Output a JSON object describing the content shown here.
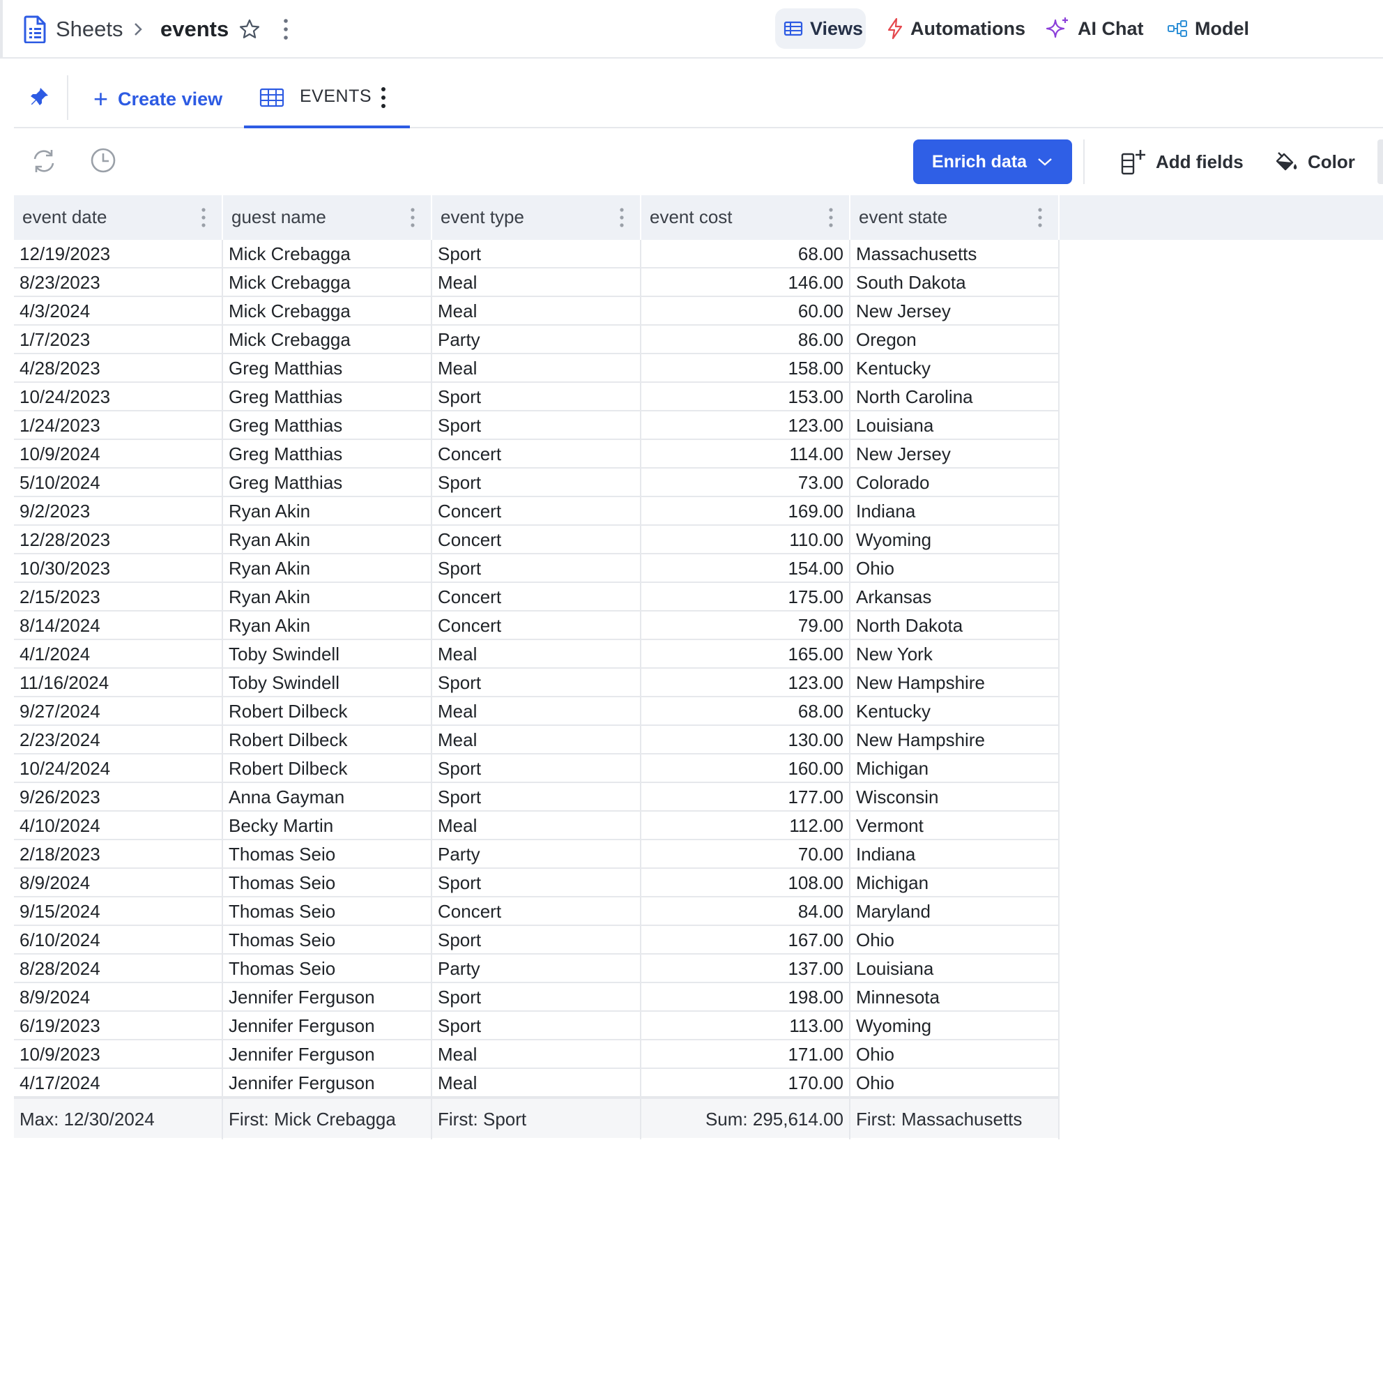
{
  "breadcrumb": {
    "root": "Sheets",
    "separator": ">",
    "current": "events"
  },
  "topnav": {
    "views": "Views",
    "automations": "Automations",
    "ai_chat": "AI Chat",
    "model": "Model"
  },
  "tabs": {
    "create_view": "Create view",
    "active_tab": "EVENTS"
  },
  "toolbar": {
    "enrich_data": "Enrich data",
    "add_fields": "Add fields",
    "color": "Color"
  },
  "colors": {
    "accent": "#2f5fe6",
    "header_bg": "#eef1f6",
    "grid_line": "#e6e8ec",
    "ai_purple": "#8b3fd9",
    "automation_red": "#e5484d"
  },
  "columns": [
    "event date",
    "guest name",
    "event type",
    "event cost",
    "event state"
  ],
  "rows": [
    [
      "12/19/2023",
      "Mick Crebagga",
      "Sport",
      "68.00",
      "Massachusetts"
    ],
    [
      "8/23/2023",
      "Mick Crebagga",
      "Meal",
      "146.00",
      "South Dakota"
    ],
    [
      "4/3/2024",
      "Mick Crebagga",
      "Meal",
      "60.00",
      "New Jersey"
    ],
    [
      "1/7/2023",
      "Mick Crebagga",
      "Party",
      "86.00",
      "Oregon"
    ],
    [
      "4/28/2023",
      "Greg Matthias",
      "Meal",
      "158.00",
      "Kentucky"
    ],
    [
      "10/24/2023",
      "Greg Matthias",
      "Sport",
      "153.00",
      "North Carolina"
    ],
    [
      "1/24/2023",
      "Greg Matthias",
      "Sport",
      "123.00",
      "Louisiana"
    ],
    [
      "10/9/2024",
      "Greg Matthias",
      "Concert",
      "114.00",
      "New Jersey"
    ],
    [
      "5/10/2024",
      "Greg Matthias",
      "Sport",
      "73.00",
      "Colorado"
    ],
    [
      "9/2/2023",
      "Ryan Akin",
      "Concert",
      "169.00",
      "Indiana"
    ],
    [
      "12/28/2023",
      "Ryan Akin",
      "Concert",
      "110.00",
      "Wyoming"
    ],
    [
      "10/30/2023",
      "Ryan Akin",
      "Sport",
      "154.00",
      "Ohio"
    ],
    [
      "2/15/2023",
      "Ryan Akin",
      "Concert",
      "175.00",
      "Arkansas"
    ],
    [
      "8/14/2024",
      "Ryan Akin",
      "Concert",
      "79.00",
      "North Dakota"
    ],
    [
      "4/1/2024",
      "Toby Swindell",
      "Meal",
      "165.00",
      "New York"
    ],
    [
      "11/16/2024",
      "Toby Swindell",
      "Sport",
      "123.00",
      "New Hampshire"
    ],
    [
      "9/27/2024",
      "Robert Dilbeck",
      "Meal",
      "68.00",
      "Kentucky"
    ],
    [
      "2/23/2024",
      "Robert Dilbeck",
      "Meal",
      "130.00",
      "New Hampshire"
    ],
    [
      "10/24/2024",
      "Robert Dilbeck",
      "Sport",
      "160.00",
      "Michigan"
    ],
    [
      "9/26/2023",
      "Anna Gayman",
      "Sport",
      "177.00",
      "Wisconsin"
    ],
    [
      "4/10/2024",
      "Becky Martin",
      "Meal",
      "112.00",
      "Vermont"
    ],
    [
      "2/18/2023",
      "Thomas Seio",
      "Party",
      "70.00",
      "Indiana"
    ],
    [
      "8/9/2024",
      "Thomas Seio",
      "Sport",
      "108.00",
      "Michigan"
    ],
    [
      "9/15/2024",
      "Thomas Seio",
      "Concert",
      "84.00",
      "Maryland"
    ],
    [
      "6/10/2024",
      "Thomas Seio",
      "Sport",
      "167.00",
      "Ohio"
    ],
    [
      "8/28/2024",
      "Thomas Seio",
      "Party",
      "137.00",
      "Louisiana"
    ],
    [
      "8/9/2024",
      "Jennifer Ferguson",
      "Sport",
      "198.00",
      "Minnesota"
    ],
    [
      "6/19/2023",
      "Jennifer Ferguson",
      "Sport",
      "113.00",
      "Wyoming"
    ],
    [
      "10/9/2023",
      "Jennifer Ferguson",
      "Meal",
      "171.00",
      "Ohio"
    ],
    [
      "4/17/2024",
      "Jennifer Ferguson",
      "Meal",
      "170.00",
      "Ohio"
    ]
  ],
  "footer": [
    "Max: 12/30/2024",
    "First: Mick Crebagga",
    "First: Sport",
    "Sum: 295,614.00",
    "First: Massachusetts"
  ],
  "icons": {
    "doc": "document-icon",
    "star": "star-icon",
    "more": "more-vertical-icon",
    "views": "table-icon",
    "automations": "lightning-icon",
    "ai": "sparkle-icon",
    "model": "diagram-icon",
    "pin": "pin-icon",
    "grid": "grid-icon",
    "refresh": "refresh-icon",
    "history": "clock-icon",
    "add_fields": "add-column-icon",
    "color": "paint-bucket-icon",
    "chevron": "chevron-down-icon"
  }
}
